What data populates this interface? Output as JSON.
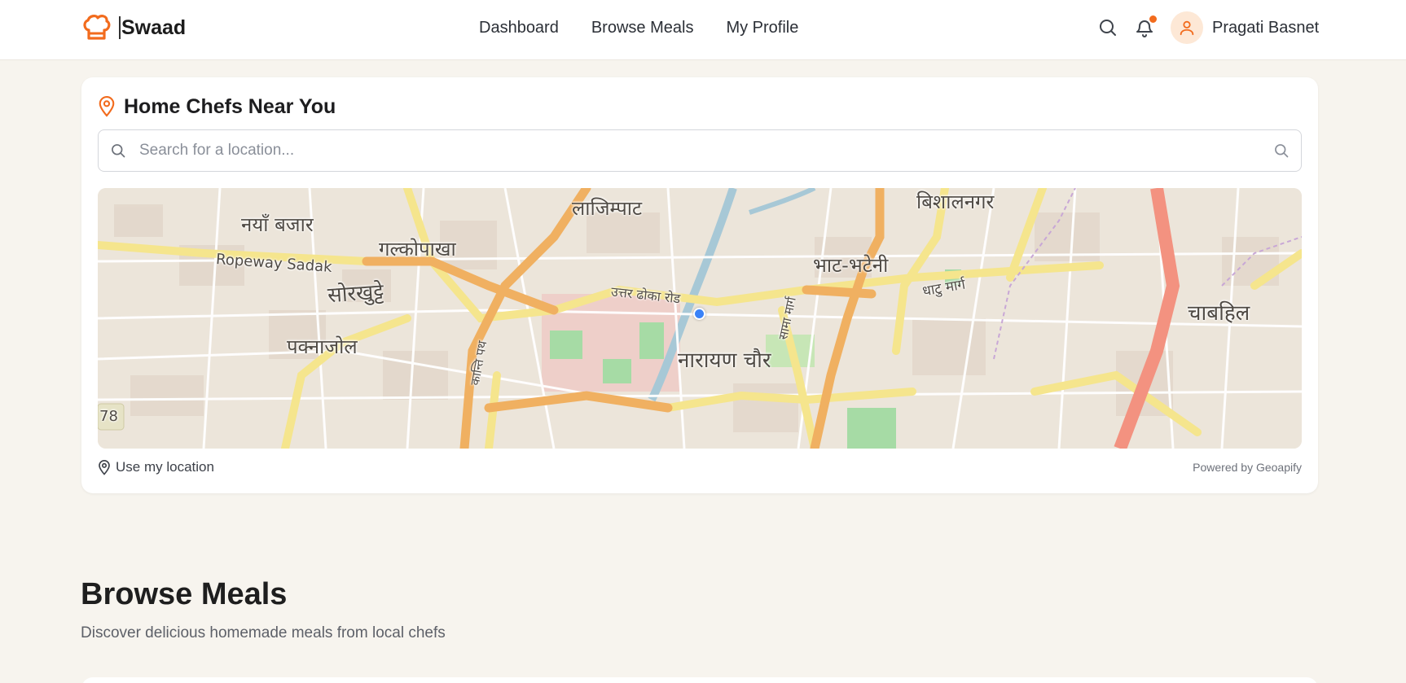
{
  "app": {
    "name": "Swaad",
    "accent": "#f26b1d"
  },
  "nav": {
    "items": [
      {
        "label": "Dashboard"
      },
      {
        "label": "Browse Meals"
      },
      {
        "label": "My Profile"
      }
    ]
  },
  "user": {
    "name": "Pragati Basnet",
    "has_notification": true
  },
  "map_card": {
    "title": "Home Chefs Near You",
    "search_placeholder": "Search for a location...",
    "use_location_label": "Use my location",
    "attribution": "Powered by Geoapify",
    "map_labels": [
      "नयाँ बजार",
      "Ropeway Sadak",
      "गल्कोपाखा",
      "लाजिम्पाट",
      "बिशालनगर",
      "सोरखुट्टे",
      "भाट-भटेनी",
      "उत्तर ढोका रोड",
      "चाबहिल",
      "पक्नाजोल",
      "नारायण चौर",
      "कान्ति पथ",
      "धाटु मार्ग",
      "सामा मार्ग",
      "78"
    ]
  },
  "browse": {
    "title": "Browse Meals",
    "subtitle": "Discover delicious homemade meals from local chefs"
  }
}
